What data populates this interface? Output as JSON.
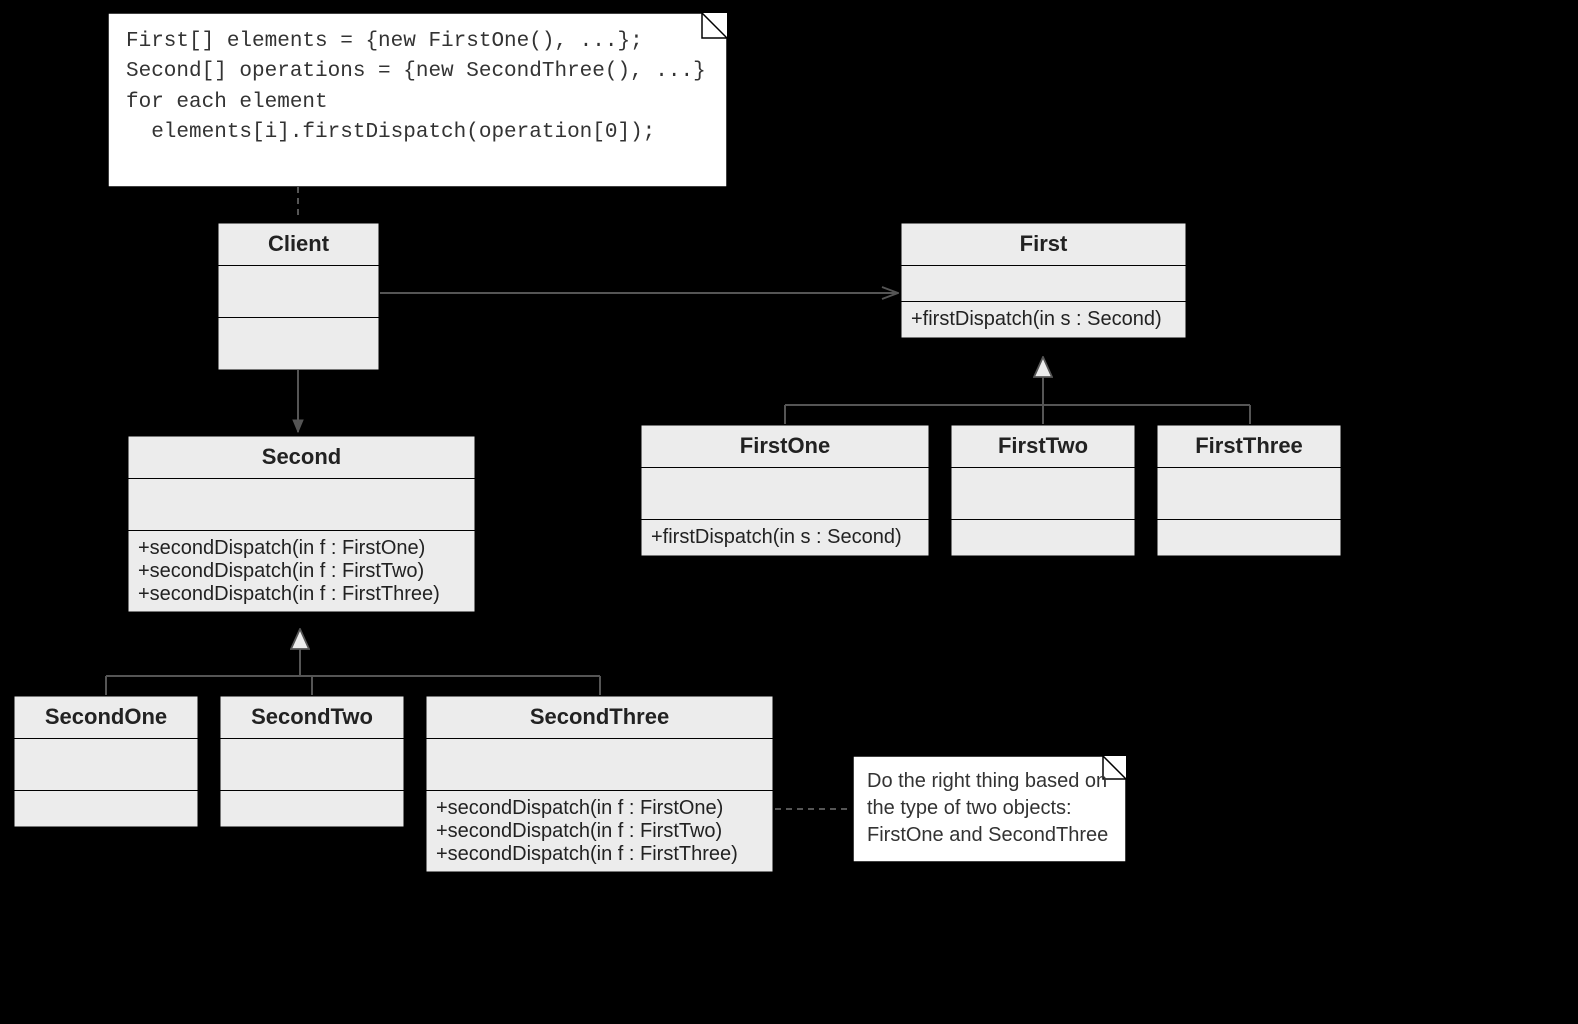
{
  "notes": {
    "code": "First[] elements = {new FirstOne(), ...};\nSecond[] operations = {new SecondThree(), ...}\nfor each element\n  elements[i].firstDispatch(operation[0]);",
    "explain": "Do the right thing based on the type of two objects: FirstOne and SecondThree"
  },
  "classes": {
    "client": {
      "name": "Client"
    },
    "first": {
      "name": "First",
      "ops": "+firstDispatch(in s : Second)"
    },
    "firstOne": {
      "name": "FirstOne",
      "ops": "+firstDispatch(in s : Second)"
    },
    "firstTwo": {
      "name": "FirstTwo"
    },
    "firstThree": {
      "name": "FirstThree"
    },
    "second": {
      "name": "Second",
      "ops": "+secondDispatch(in f : FirstOne)\n+secondDispatch(in f : FirstTwo)\n+secondDispatch(in f : FirstThree)"
    },
    "secondOne": {
      "name": "SecondOne"
    },
    "secondTwo": {
      "name": "SecondTwo"
    },
    "secondThree": {
      "name": "SecondThree",
      "ops": "+secondDispatch(in f : FirstOne)\n+secondDispatch(in f : FirstTwo)\n+secondDispatch(in f : FirstThree)"
    }
  }
}
